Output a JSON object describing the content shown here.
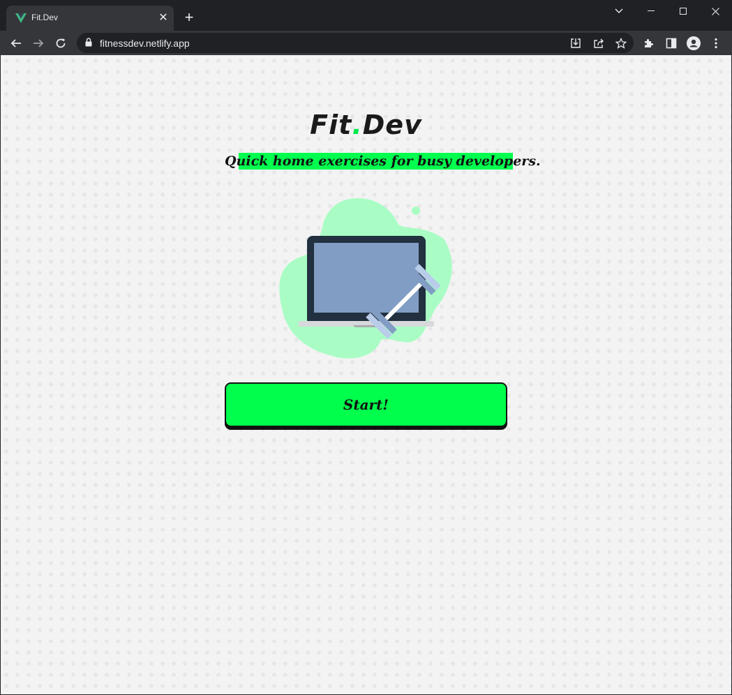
{
  "browser": {
    "tab_title": "Fit.Dev",
    "url": "fitnessdev.netlify.app",
    "favicon": "vue-logo-icon"
  },
  "page": {
    "logo_fit": "Fit",
    "logo_dot": ".",
    "logo_dev": "Dev",
    "tagline": "Quick home exercises for busy developers.",
    "start_label": "Start!",
    "illustration": "laptop-dumbbell-illustration"
  },
  "colors": {
    "accent_green": "#00ff4c",
    "blob_green": "#a9fdc4",
    "laptop_screen": "#819dc4",
    "laptop_frame": "#22303f",
    "text_dark": "#111111"
  }
}
